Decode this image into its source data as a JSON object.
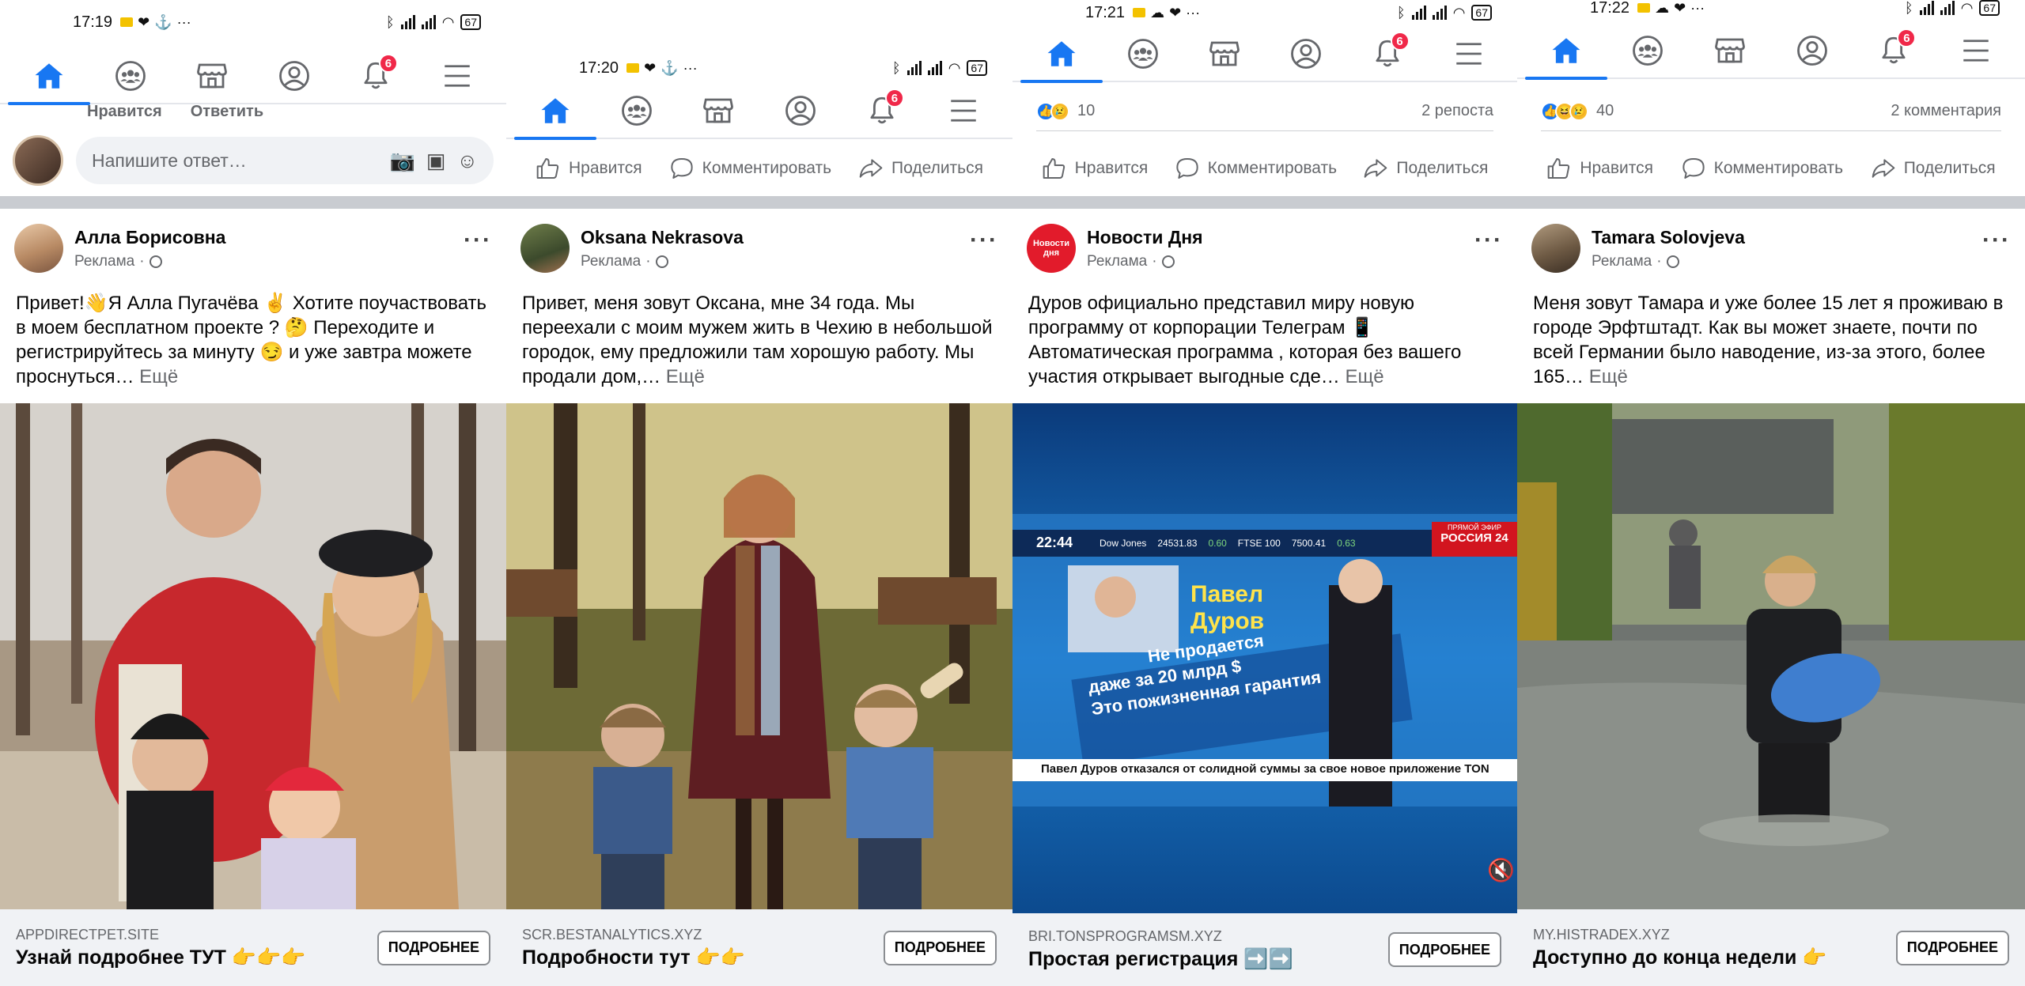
{
  "colors": {
    "accent": "#1877f2",
    "badge": "#f02849",
    "divider": "#c9ccd1",
    "cta_bg": "#f0f2f5"
  },
  "icons": {
    "home": "home-icon",
    "groups": "groups-icon",
    "marketplace": "marketplace-icon",
    "profile": "profile-icon",
    "notifications": "bell-icon",
    "menu": "menu-icon"
  },
  "nav": {
    "badge_count": "6"
  },
  "actions": {
    "like": "Нравится",
    "comment": "Комментировать",
    "share": "Поделиться"
  },
  "panel1": {
    "time": "17:19",
    "battery": "67",
    "comment_like": "Нравится",
    "comment_reply": "Ответить",
    "reply_placeholder": "Напишите ответ…",
    "post": {
      "author": "Алла Борисовна",
      "sponsored": "Реклама",
      "text": "Привет!👋Я Алла Пугачёва ✌️ Хотите поучаствовать в моем бесплатном проекте ? 🤔 Переходите и регистрируйтесь за минуту 😏 и уже завтра можете проснуться…",
      "more": "Ещё",
      "domain": "APPDIRECTPET.SITE",
      "headline": "Узнай подробнее ТУТ 👉👉👉",
      "cta": "ПОДРОБНЕЕ"
    }
  },
  "panel2": {
    "time": "17:20",
    "battery": "67",
    "post": {
      "author": "Oksana Nekrasova",
      "sponsored": "Реклама",
      "text": "Привет, меня зовут Оксана, мне 34 года. Мы переехали с моим мужем жить в Чехию в небольшой городок, ему предложили там хорошую работу. Мы продали дом,…",
      "more": "Ещё",
      "domain": "SCR.BESTANALYTICS.XYZ",
      "headline": "Подробности тут 👉👉",
      "cta": "ПОДРОБНЕЕ"
    }
  },
  "panel3": {
    "time": "17:21",
    "battery": "67",
    "reaction_count": "10",
    "reaction_right": "2 репоста",
    "post": {
      "author": "Новости Дня",
      "avatar_text": "Новости дня",
      "sponsored": "Реклама",
      "text": "Дуров официально представил миру новую программу от корпорации Телеграм 📱 Автоматическая программа , которая без вашего участия открывает выгодные сде…",
      "more": "Ещё",
      "domain": "BRI.TONSPROGRAMSM.XYZ",
      "headline": "Простая регистрация ➡️➡️",
      "cta": "ПОДРОБНЕЕ"
    },
    "video": {
      "time": "22:44",
      "ticker1": "Dow Jones",
      "ticker2": "24531.83",
      "ticker3": "0.60",
      "ticker4": "FTSE 100",
      "ticker5": "7500.41",
      "ticker6": "0.63",
      "channel_top": "ПРЯМОЙ ЭФИР",
      "channel": "РОССИЯ 24",
      "name_line1": "Павел",
      "name_line2": "Дуров",
      "quote1": "Не продается",
      "quote2": "даже за 20 млрд $",
      "quote3": "Это пожизненная гарантия",
      "caption": "Павел Дуров отказался от солидной суммы за свое новое приложение TON"
    }
  },
  "panel4": {
    "time": "17:22",
    "battery": "67",
    "reaction_count": "40",
    "reaction_right": "2 комментария",
    "post": {
      "author": "Tamara Solovjeva",
      "sponsored": "Реклама",
      "text": "Меня зовут Тамара и уже более 15 лет я проживаю в городе Эрфтштадт. Как вы может знаете, почти по всей Германии было наводение, из-за этого, более 165…",
      "more": "Ещё",
      "domain": "MY.HISTRADEX.XYZ",
      "headline": "Доступно до конца недели 👉",
      "cta": "ПОДРОБНЕЕ"
    }
  }
}
